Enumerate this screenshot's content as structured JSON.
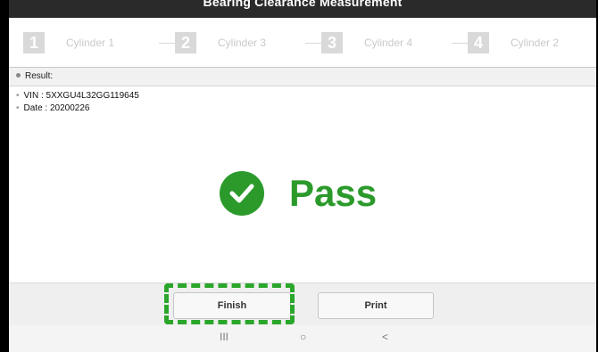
{
  "app": {
    "title": "Bearing Clearance Measurement"
  },
  "steps": [
    {
      "number": "1",
      "label": "Cylinder 1"
    },
    {
      "number": "2",
      "label": "Cylinder 3"
    },
    {
      "number": "3",
      "label": "Cylinder 4"
    },
    {
      "number": "4",
      "label": "Cylinder 2"
    }
  ],
  "result": {
    "heading": "Result:",
    "vin": "VIN : 5XXGU4L32GG119645",
    "date": "Date : 20200226",
    "status": "Pass"
  },
  "actions": {
    "finish_label": "Finish",
    "print_label": "Print"
  },
  "navbar": {
    "recent_icon": "III",
    "home_icon": "○",
    "back_icon": "<"
  },
  "colors": {
    "pass_green": "#2b9a2b",
    "highlight_green": "#2aa62a",
    "step_gray": "#d9d9d9"
  }
}
